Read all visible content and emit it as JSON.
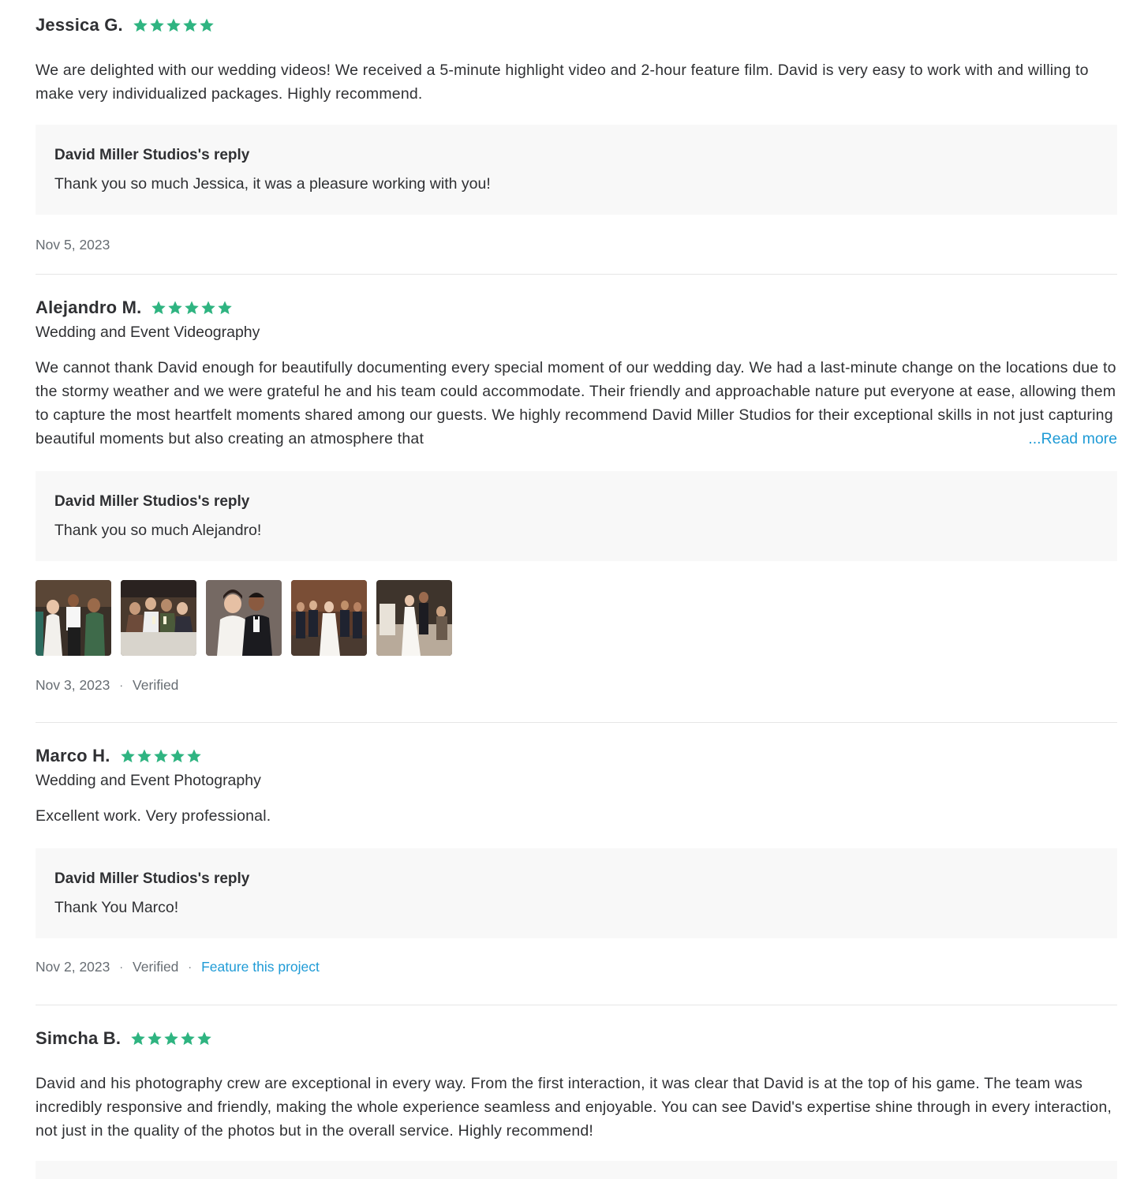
{
  "colors": {
    "star_green": "#2fb481",
    "link_blue": "#1f9bd6",
    "reply_bg": "#f8f8f8",
    "text": "#2f3033",
    "meta_text": "#676d73"
  },
  "reviews": [
    {
      "name": "Jessica G.",
      "rating": 5,
      "service": "",
      "body": "We are delighted with our wedding videos! We received a 5-minute highlight video and 2-hour feature film. David is very easy to work with and willing to make very individualized packages. Highly recommend.",
      "reply_title": "David Miller Studios's reply",
      "reply_text": "Thank you so much Jessica, it was a pleasure working with you!",
      "date": "Nov 5, 2023"
    },
    {
      "name": "Alejandro M.",
      "rating": 5,
      "service": "Wedding and Event Videography",
      "body": "We cannot thank David enough for beautifully documenting every special moment of our wedding day. We had a last-minute change on the locations due to the stormy weather and we were grateful he and his team could accommodate. Their friendly and approachable nature put everyone at ease, allowing them to capture the most heartfelt moments shared among our guests. We highly recommend David Miller Studios for their exceptional skills in not just capturing beautiful moments but also creating an atmosphere that",
      "read_more": "...Read more",
      "reply_title": "David Miller Studios's reply",
      "reply_text": "Thank you so much Alejandro!",
      "photos": [
        "wedding-guests-photo",
        "toast-photo",
        "couple-portrait-photo",
        "wedding-party-photo",
        "couple-entrance-photo"
      ],
      "date": "Nov 3, 2023",
      "verified": "Verified"
    },
    {
      "name": "Marco H.",
      "rating": 5,
      "service": "Wedding and Event Photography",
      "body": "Excellent work. Very professional.",
      "reply_title": "David Miller Studios's reply",
      "reply_text": "Thank You Marco!",
      "date": "Nov 2, 2023",
      "verified": "Verified",
      "feature_link": "Feature this project"
    },
    {
      "name": "Simcha B.",
      "rating": 5,
      "service": "",
      "body": "David and his photography crew are exceptional in every way. From the first interaction, it was clear that David is at the top of his game. The team was incredibly responsive and friendly, making the whole experience seamless and enjoyable. You can see David's expertise shine through in every interaction, not just in the quality of the photos but in the overall service. Highly recommend!"
    }
  ]
}
